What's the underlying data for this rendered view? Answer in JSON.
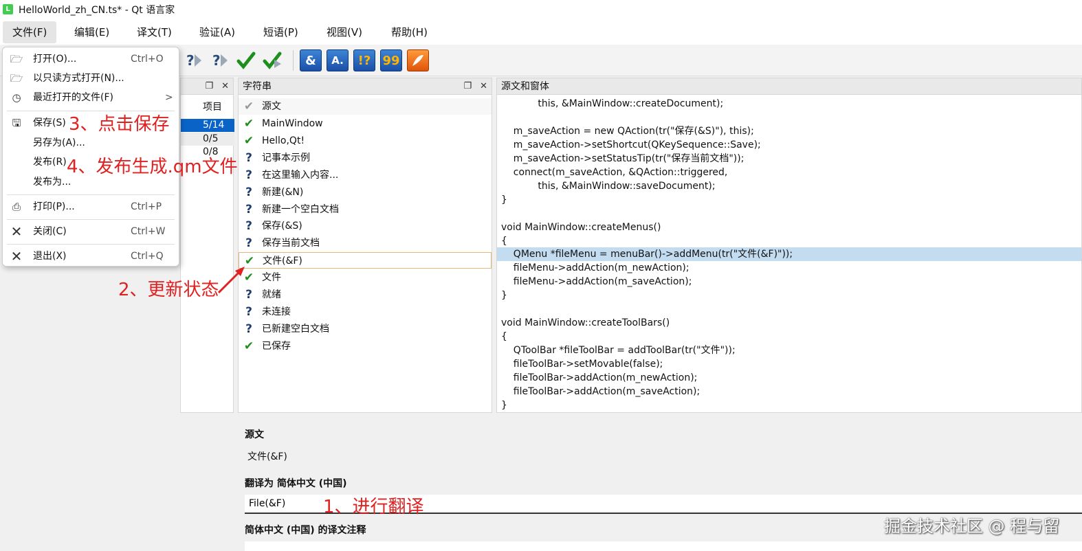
{
  "window": {
    "title": "HelloWorld_zh_CN.ts* - Qt 语言家",
    "app_icon": "L"
  },
  "menubar": [
    {
      "label": "文件(F)",
      "active": true
    },
    {
      "label": "编辑(E)"
    },
    {
      "label": "译文(T)"
    },
    {
      "label": "验证(A)"
    },
    {
      "label": "短语(P)"
    },
    {
      "label": "视图(V)"
    },
    {
      "label": "帮助(H)"
    }
  ],
  "toolbar": {
    "buttons": [
      "prev-unfinished-icon",
      "next-unfinished-icon",
      "done-next-icon",
      "done-icon",
      "accelerator-check-icon",
      "ending-check-icon",
      "phrase-check-icon",
      "place-marker-check-icon",
      "translation-check-icon"
    ],
    "blue_labels": {
      "accel": "&",
      "ending": "A.",
      "phrase": "!?",
      "quote": "99"
    }
  },
  "file_menu": {
    "open": {
      "label": "打开(O)...",
      "shortcut": "Ctrl+O"
    },
    "open_readonly": {
      "label": "以只读方式打开(N)..."
    },
    "recent": {
      "label": "最近打开的文件(F)",
      "arrow": ">"
    },
    "save": {
      "label": "保存(S)"
    },
    "save_as": {
      "label": "另存为(A)..."
    },
    "release": {
      "label": "发布(R)"
    },
    "release_as": {
      "label": "发布为..."
    },
    "print": {
      "label": "打印(P)...",
      "shortcut": "Ctrl+P"
    },
    "close": {
      "label": "关闭(C)",
      "shortcut": "Ctrl+W"
    },
    "exit": {
      "label": "退出(X)",
      "shortcut": "Ctrl+Q"
    }
  },
  "context_panel": {
    "header": "项目",
    "rows": [
      "5/14",
      "0/5",
      "0/8"
    ]
  },
  "strings_panel": {
    "title": "字符串",
    "header": "源文",
    "rows": [
      {
        "text": "MainWindow",
        "status": "done"
      },
      {
        "text": "Hello,Qt!",
        "status": "done"
      },
      {
        "text": "记事本示例",
        "status": "unfinished"
      },
      {
        "text": "在这里输入内容...",
        "status": "unfinished"
      },
      {
        "text": "新建(&N)",
        "status": "unfinished"
      },
      {
        "text": "新建一个空白文档",
        "status": "unfinished"
      },
      {
        "text": "保存(&S)",
        "status": "unfinished"
      },
      {
        "text": "保存当前文档",
        "status": "unfinished"
      },
      {
        "text": "文件(&F)",
        "status": "done",
        "selected": true
      },
      {
        "text": "文件",
        "status": "done"
      },
      {
        "text": "就绪",
        "status": "unfinished"
      },
      {
        "text": "未连接",
        "status": "unfinished"
      },
      {
        "text": "已新建空白文档",
        "status": "unfinished"
      },
      {
        "text": "已保存",
        "status": "done"
      }
    ]
  },
  "source_panel": {
    "title": "源文和窗体",
    "lines": [
      "            this, &MainWindow::createDocument);",
      "",
      "    m_saveAction = new QAction(tr(\"保存(&S)\"), this);",
      "    m_saveAction->setShortcut(QKeySequence::Save);",
      "    m_saveAction->setStatusTip(tr(\"保存当前文档\"));",
      "    connect(m_saveAction, &QAction::triggered,",
      "            this, &MainWindow::saveDocument);",
      "}",
      "",
      "void MainWindow::createMenus()",
      "{",
      "    QMenu *fileMenu = menuBar()->addMenu(tr(\"文件(&F)\"));",
      "    fileMenu->addAction(m_newAction);",
      "    fileMenu->addAction(m_saveAction);",
      "}",
      "",
      "void MainWindow::createToolBars()",
      "{",
      "    QToolBar *fileToolBar = addToolBar(tr(\"文件\"));",
      "    fileToolBar->setMovable(false);",
      "    fileToolBar->addAction(m_newAction);",
      "    fileToolBar->addAction(m_saveAction);",
      "}"
    ],
    "highlight_index": 11
  },
  "editor": {
    "source_label": "源文",
    "source_text": "文件(&F)",
    "translate_label": "翻译为 简体中文 (中国)",
    "translation_value": "File(&F)",
    "comment_label": "简体中文 (中国) 的译文注释"
  },
  "annotations": {
    "step1": "1、进行翻译",
    "step2": "2、更新状态",
    "step3": "3、点击保存",
    "step4": "4、发布生成.qm文件"
  },
  "watermark": "掘金技术社区 @ 程与留",
  "colors": {
    "annotation": "#e12020",
    "highlight": "#c4dcf0",
    "check": "#1e8f1e"
  }
}
